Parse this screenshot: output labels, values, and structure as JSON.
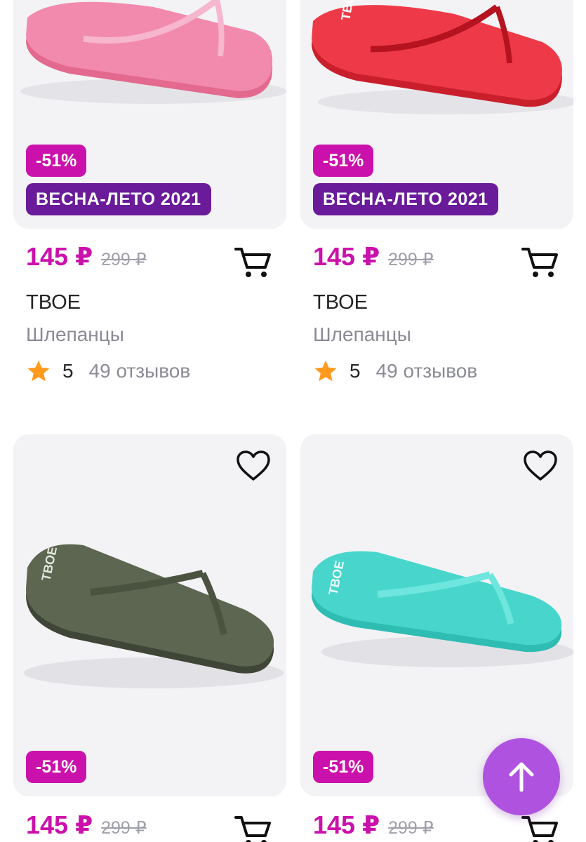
{
  "products": [
    {
      "id": "p1",
      "discount": "-51%",
      "season": "ВЕСНА-ЛЕТО 2021",
      "price": "145 ₽",
      "old_price": "299 ₽",
      "brand": "ТВОЕ",
      "category": "Шлепанцы",
      "rating": "5",
      "reviews": "49 отзывов",
      "color": "#f07aa0"
    },
    {
      "id": "p2",
      "discount": "-51%",
      "season": "ВЕСНА-ЛЕТО 2021",
      "price": "145 ₽",
      "old_price": "299 ₽",
      "brand": "ТВОЕ",
      "category": "Шлепанцы",
      "rating": "5",
      "reviews": "49 отзывов",
      "color": "#e8283a"
    },
    {
      "id": "p3",
      "discount": "-51%",
      "price": "145 ₽",
      "old_price": "299 ₽",
      "color": "#5c6650"
    },
    {
      "id": "p4",
      "discount": "-51%",
      "price": "145 ₽",
      "old_price": "299 ₽",
      "color": "#48d6cc"
    }
  ],
  "icons": {
    "favorite": "heart-icon",
    "cart": "cart-icon",
    "rating": "star-icon",
    "scroll_top": "arrow-up-icon"
  },
  "colors": {
    "accent": "#cb11ab",
    "season_badge": "#6a1b9a",
    "star": "#ff9a1e",
    "fab": "#b052e0"
  }
}
